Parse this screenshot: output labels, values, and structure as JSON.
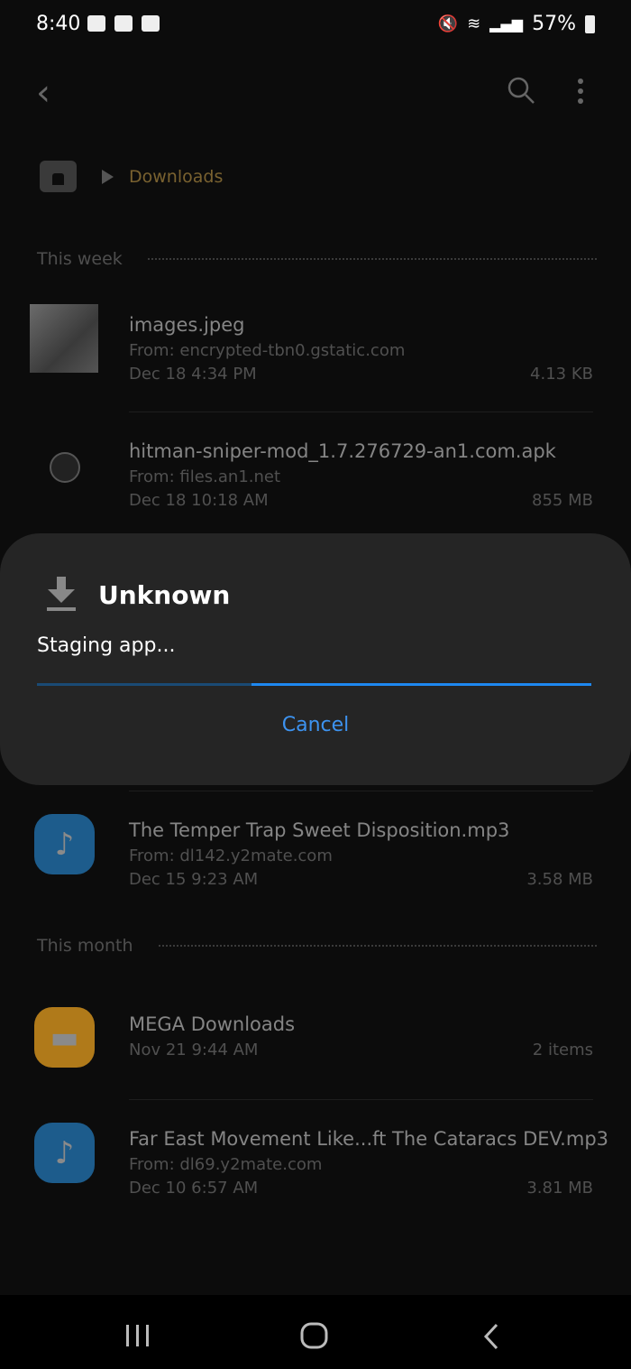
{
  "status_bar": {
    "time": "8:40",
    "battery": "57%",
    "icons": [
      "image-icon",
      "app-9-icon",
      "app-9-icon",
      "mute-icon",
      "wifi-icon",
      "signal-icon",
      "battery-icon"
    ]
  },
  "toolbar": {
    "back": "back-icon",
    "search": "search-icon",
    "more": "more-options-icon"
  },
  "breadcrumb": {
    "current": "Downloads"
  },
  "sections": [
    {
      "label": "This week",
      "items": [
        {
          "name": "images.jpeg",
          "from": "From: encrypted-tbn0.gstatic.com",
          "date": "Dec 18 4:34 PM",
          "size": "4.13 KB"
        },
        {
          "name": "hitman-sniper-mod_1.7.276729-an1.com.apk",
          "from": "From: files.an1.net",
          "date": "Dec 18 10:18 AM",
          "size": "855 MB"
        },
        {
          "name": "The Temper Trap  Sweet Disposition.mp3",
          "from": "From: dl142.y2mate.com",
          "date": "Dec 15 9:23 AM",
          "size": "3.58 MB"
        }
      ]
    },
    {
      "label": "This month",
      "items": [
        {
          "name": "MEGA Downloads",
          "date": "Nov 21 9:44 AM",
          "size": "2 items"
        },
        {
          "name": "Far East Movement  Like...ft The Cataracs DEV.mp3",
          "from": "From: dl69.y2mate.com",
          "date": "Dec 10 6:57 AM",
          "size": "3.81 MB"
        }
      ]
    }
  ],
  "dialog": {
    "title": "Unknown",
    "message": "Staging app...",
    "cancel": "Cancel",
    "progress": "indeterminate"
  },
  "colors": {
    "accent": "#3d93f0",
    "folder": "#b07a1a",
    "music": "#1d5c8c",
    "breadcrumb": "#7a6230"
  }
}
